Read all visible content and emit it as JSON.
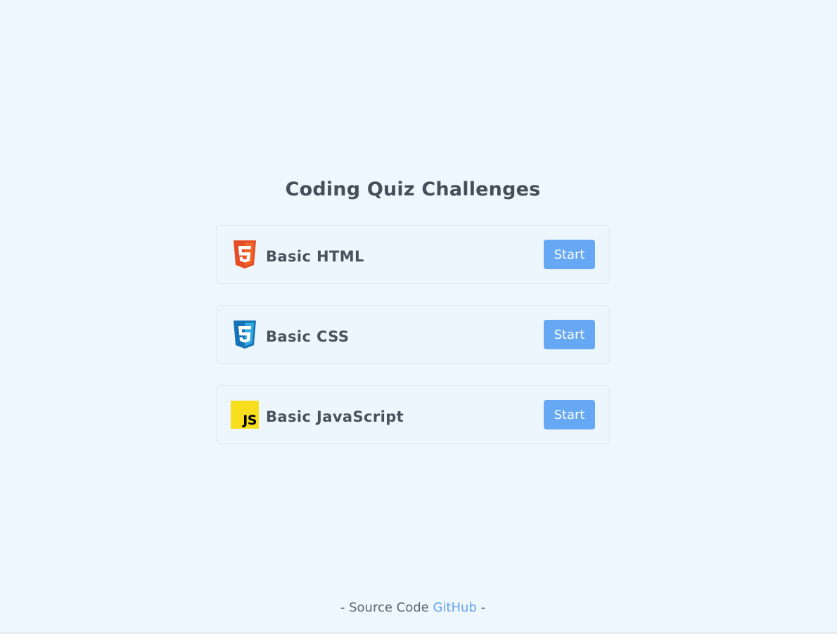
{
  "page": {
    "title": "Coding Quiz Challenges"
  },
  "quizzes": [
    {
      "title": "Basic HTML",
      "icon": "html5-icon",
      "start_label": "Start",
      "icon_color": "#e44d26"
    },
    {
      "title": "Basic CSS",
      "icon": "css3-icon",
      "start_label": "Start",
      "icon_color": "#1f8ff2"
    },
    {
      "title": "Basic JavaScript",
      "icon": "javascript-icon",
      "start_label": "Start",
      "icon_color": "#f7df1e",
      "icon_text": "JS"
    }
  ],
  "footer": {
    "prefix": "- Source Code ",
    "link_text": "GitHub",
    "suffix": " -"
  },
  "colors": {
    "background": "#eff7fe",
    "button": "#67a8f4",
    "link": "#62a3ef"
  }
}
